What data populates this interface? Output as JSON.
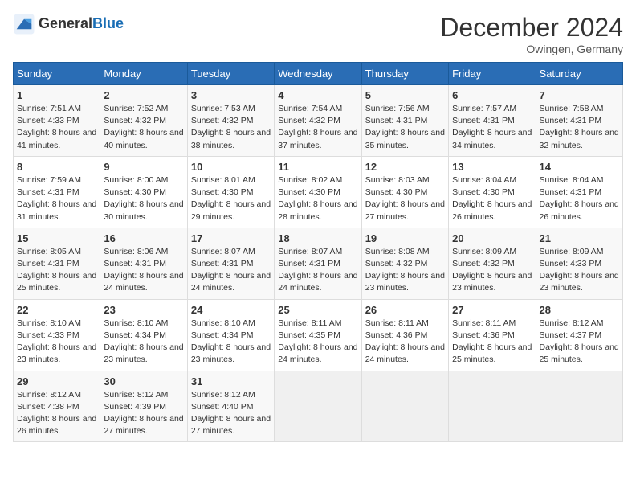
{
  "header": {
    "logo_text_general": "General",
    "logo_text_blue": "Blue",
    "month_title": "December 2024",
    "location": "Owingen, Germany"
  },
  "weekdays": [
    "Sunday",
    "Monday",
    "Tuesday",
    "Wednesday",
    "Thursday",
    "Friday",
    "Saturday"
  ],
  "weeks": [
    [
      {
        "day": "1",
        "sunrise": "7:51 AM",
        "sunset": "4:33 PM",
        "daylight": "8 hours and 41 minutes."
      },
      {
        "day": "2",
        "sunrise": "7:52 AM",
        "sunset": "4:32 PM",
        "daylight": "8 hours and 40 minutes."
      },
      {
        "day": "3",
        "sunrise": "7:53 AM",
        "sunset": "4:32 PM",
        "daylight": "8 hours and 38 minutes."
      },
      {
        "day": "4",
        "sunrise": "7:54 AM",
        "sunset": "4:32 PM",
        "daylight": "8 hours and 37 minutes."
      },
      {
        "day": "5",
        "sunrise": "7:56 AM",
        "sunset": "4:31 PM",
        "daylight": "8 hours and 35 minutes."
      },
      {
        "day": "6",
        "sunrise": "7:57 AM",
        "sunset": "4:31 PM",
        "daylight": "8 hours and 34 minutes."
      },
      {
        "day": "7",
        "sunrise": "7:58 AM",
        "sunset": "4:31 PM",
        "daylight": "8 hours and 32 minutes."
      }
    ],
    [
      {
        "day": "8",
        "sunrise": "7:59 AM",
        "sunset": "4:31 PM",
        "daylight": "8 hours and 31 minutes."
      },
      {
        "day": "9",
        "sunrise": "8:00 AM",
        "sunset": "4:30 PM",
        "daylight": "8 hours and 30 minutes."
      },
      {
        "day": "10",
        "sunrise": "8:01 AM",
        "sunset": "4:30 PM",
        "daylight": "8 hours and 29 minutes."
      },
      {
        "day": "11",
        "sunrise": "8:02 AM",
        "sunset": "4:30 PM",
        "daylight": "8 hours and 28 minutes."
      },
      {
        "day": "12",
        "sunrise": "8:03 AM",
        "sunset": "4:30 PM",
        "daylight": "8 hours and 27 minutes."
      },
      {
        "day": "13",
        "sunrise": "8:04 AM",
        "sunset": "4:30 PM",
        "daylight": "8 hours and 26 minutes."
      },
      {
        "day": "14",
        "sunrise": "8:04 AM",
        "sunset": "4:31 PM",
        "daylight": "8 hours and 26 minutes."
      }
    ],
    [
      {
        "day": "15",
        "sunrise": "8:05 AM",
        "sunset": "4:31 PM",
        "daylight": "8 hours and 25 minutes."
      },
      {
        "day": "16",
        "sunrise": "8:06 AM",
        "sunset": "4:31 PM",
        "daylight": "8 hours and 24 minutes."
      },
      {
        "day": "17",
        "sunrise": "8:07 AM",
        "sunset": "4:31 PM",
        "daylight": "8 hours and 24 minutes."
      },
      {
        "day": "18",
        "sunrise": "8:07 AM",
        "sunset": "4:31 PM",
        "daylight": "8 hours and 24 minutes."
      },
      {
        "day": "19",
        "sunrise": "8:08 AM",
        "sunset": "4:32 PM",
        "daylight": "8 hours and 23 minutes."
      },
      {
        "day": "20",
        "sunrise": "8:09 AM",
        "sunset": "4:32 PM",
        "daylight": "8 hours and 23 minutes."
      },
      {
        "day": "21",
        "sunrise": "8:09 AM",
        "sunset": "4:33 PM",
        "daylight": "8 hours and 23 minutes."
      }
    ],
    [
      {
        "day": "22",
        "sunrise": "8:10 AM",
        "sunset": "4:33 PM",
        "daylight": "8 hours and 23 minutes."
      },
      {
        "day": "23",
        "sunrise": "8:10 AM",
        "sunset": "4:34 PM",
        "daylight": "8 hours and 23 minutes."
      },
      {
        "day": "24",
        "sunrise": "8:10 AM",
        "sunset": "4:34 PM",
        "daylight": "8 hours and 23 minutes."
      },
      {
        "day": "25",
        "sunrise": "8:11 AM",
        "sunset": "4:35 PM",
        "daylight": "8 hours and 24 minutes."
      },
      {
        "day": "26",
        "sunrise": "8:11 AM",
        "sunset": "4:36 PM",
        "daylight": "8 hours and 24 minutes."
      },
      {
        "day": "27",
        "sunrise": "8:11 AM",
        "sunset": "4:36 PM",
        "daylight": "8 hours and 25 minutes."
      },
      {
        "day": "28",
        "sunrise": "8:12 AM",
        "sunset": "4:37 PM",
        "daylight": "8 hours and 25 minutes."
      }
    ],
    [
      {
        "day": "29",
        "sunrise": "8:12 AM",
        "sunset": "4:38 PM",
        "daylight": "8 hours and 26 minutes."
      },
      {
        "day": "30",
        "sunrise": "8:12 AM",
        "sunset": "4:39 PM",
        "daylight": "8 hours and 27 minutes."
      },
      {
        "day": "31",
        "sunrise": "8:12 AM",
        "sunset": "4:40 PM",
        "daylight": "8 hours and 27 minutes."
      },
      null,
      null,
      null,
      null
    ]
  ]
}
